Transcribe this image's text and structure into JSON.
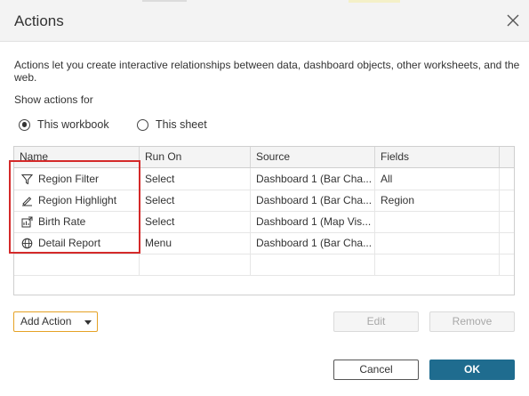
{
  "dialog": {
    "title": "Actions",
    "description": "Actions let you create interactive relationships between data, dashboard objects, other worksheets, and the web.",
    "show_actions_for": "Show actions for",
    "options": [
      {
        "label": "This workbook",
        "selected": true
      },
      {
        "label": "This sheet",
        "selected": false
      }
    ]
  },
  "table": {
    "columns": [
      "Name",
      "Run On",
      "Source",
      "Fields"
    ],
    "rows": [
      {
        "icon": "filter-icon",
        "name": "Region Filter",
        "run_on": "Select",
        "source": "Dashboard 1 (Bar Cha...",
        "fields": "All"
      },
      {
        "icon": "highlight-icon",
        "name": "Region Highlight",
        "run_on": "Select",
        "source": "Dashboard 1 (Bar Cha...",
        "fields": "Region"
      },
      {
        "icon": "go-to-sheet-icon",
        "name": "Birth Rate",
        "run_on": "Select",
        "source": "Dashboard 1 (Map Vis...",
        "fields": ""
      },
      {
        "icon": "globe-icon",
        "name": "Detail Report",
        "run_on": "Menu",
        "source": "Dashboard 1 (Bar Cha...",
        "fields": ""
      }
    ]
  },
  "buttons": {
    "add_action": "Add Action",
    "edit": "Edit",
    "remove": "Remove",
    "cancel": "Cancel",
    "ok": "OK"
  },
  "colors": {
    "highlight_border": "#d42a2a",
    "add_action_border": "#e5a225",
    "ok_background": "#1f6c8f"
  }
}
